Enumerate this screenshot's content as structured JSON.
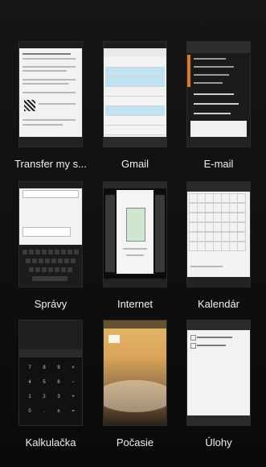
{
  "apps": [
    {
      "name": "Transfer my s..."
    },
    {
      "name": "Gmail"
    },
    {
      "name": "E-mail"
    },
    {
      "name": "Správy"
    },
    {
      "name": "Internet"
    },
    {
      "name": "Kalendár"
    },
    {
      "name": "Kalkulačka"
    },
    {
      "name": "Počasie"
    },
    {
      "name": "Úlohy"
    }
  ],
  "colors": {
    "background": "#0d0d0d",
    "gmail_highlight": "#bfe3f0",
    "email_accent": "#e07a1f",
    "weather_sky": "#d9a55a"
  }
}
